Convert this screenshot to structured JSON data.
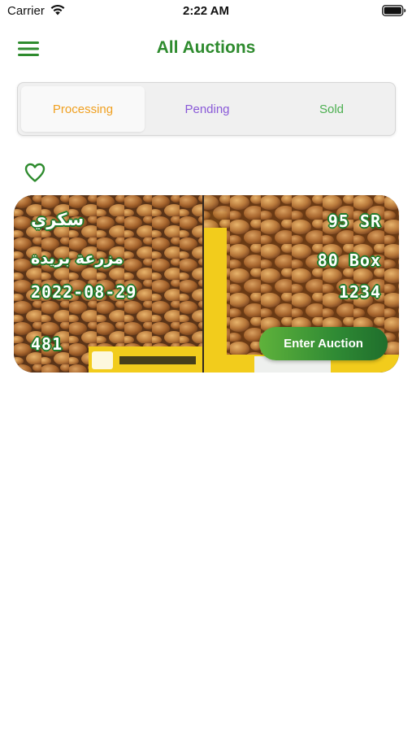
{
  "status_bar": {
    "carrier": "Carrier",
    "time": "2:22 AM"
  },
  "nav": {
    "title": "All Auctions",
    "menu_icon": "hamburger-menu-icon"
  },
  "tabs": [
    {
      "label": "Processing",
      "color": "#f0a020",
      "selected": true
    },
    {
      "label": "Pending",
      "color": "#8a5ad8",
      "selected": false
    },
    {
      "label": "Sold",
      "color": "#4caf50",
      "selected": false
    }
  ],
  "favorite": {
    "icon": "heart-outline-icon",
    "color": "#2e8b2e"
  },
  "auction_card": {
    "product_name": "سكري",
    "farm": "مزرعة بريدة",
    "date": "2022-08-29",
    "id": "481",
    "price": "95 SR",
    "quantity": "80 Box",
    "lot_number": "1234",
    "enter_label": "Enter Auction"
  },
  "colors": {
    "accent_green": "#2e8b2e",
    "text_outline": "#1f7a2a"
  }
}
